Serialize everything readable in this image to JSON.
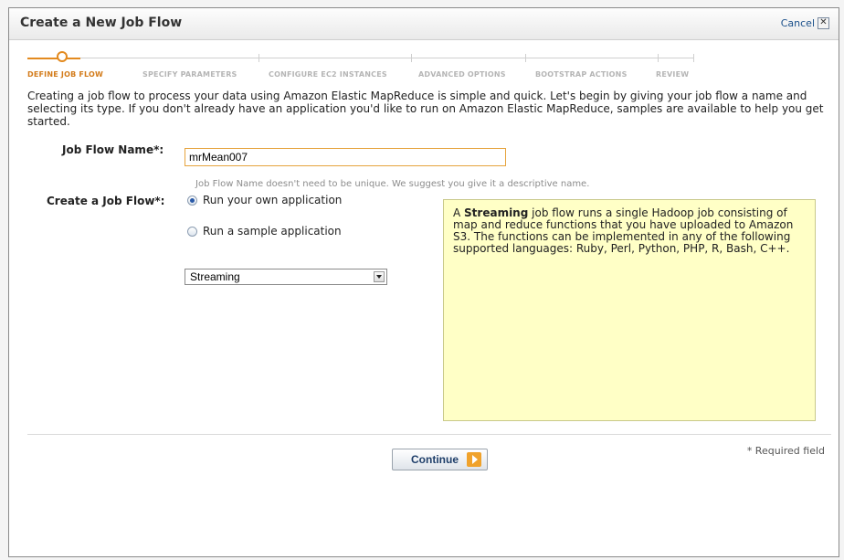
{
  "dialog": {
    "title": "Create a New Job Flow",
    "cancel_label": "Cancel",
    "cancel_icon": "close-icon"
  },
  "steps": [
    {
      "label": "DEFINE JOB FLOW",
      "active": true
    },
    {
      "label": "SPECIFY PARAMETERS",
      "active": false
    },
    {
      "label": "CONFIGURE EC2 INSTANCES",
      "active": false
    },
    {
      "label": "ADVANCED OPTIONS",
      "active": false
    },
    {
      "label": "BOOTSTRAP ACTIONS",
      "active": false
    },
    {
      "label": "REVIEW",
      "active": false
    }
  ],
  "intro": "Creating a job flow to process your data using Amazon Elastic MapReduce is simple and quick. Let's begin by giving your job flow a name and selecting its type. If you don't already have an application you'd like to run on Amazon Elastic MapReduce, samples are available to help you get started.",
  "form": {
    "name_label": "Job Flow Name*:",
    "name_value": "mrMean007",
    "name_hint": "Job Flow Name doesn't need to be unique. We suggest you give it a descriptive name.",
    "type_label": "Create a Job Flow*:",
    "radio_own": "Run your own application",
    "radio_sample": "Run a sample application",
    "selected_radio": "own",
    "select_value": "Streaming"
  },
  "info": {
    "prefix": "A ",
    "bold": "Streaming",
    "rest": " job flow runs a single Hadoop job consisting of map and reduce functions that you have uploaded to Amazon S3. The functions can be implemented in any of the following supported languages: Ruby, Perl, Python, PHP, R, Bash, C++."
  },
  "footer": {
    "required_note": "* Required field",
    "continue_label": "Continue"
  },
  "colors": {
    "accent": "#e38a1f",
    "infobox_bg": "#ffffc6",
    "link": "#1a4f8a"
  }
}
